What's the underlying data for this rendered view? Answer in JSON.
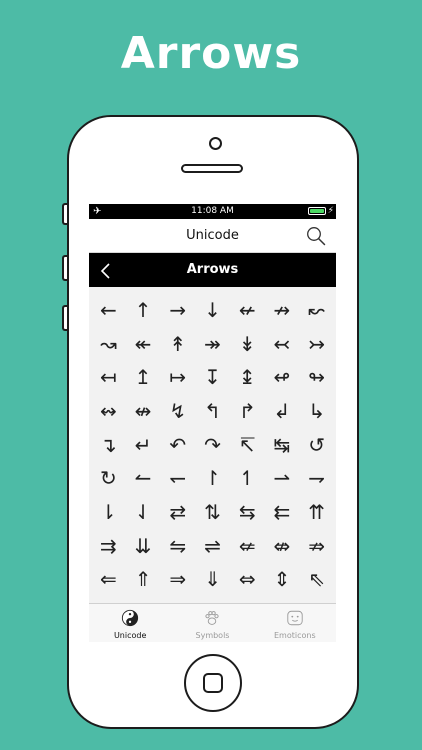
{
  "banner": {
    "title": "Arrows"
  },
  "status_bar": {
    "time": "11:08 AM",
    "airplane_glyph": "✈",
    "charging_glyph": "⚡"
  },
  "nav_bar": {
    "title": "Unicode",
    "search_icon": "search-icon"
  },
  "header": {
    "title": "Arrows",
    "back_glyph": "‹"
  },
  "arrows": [
    "←",
    "↑",
    "→",
    "↓",
    "↚",
    "↛",
    "↜",
    "↝",
    "↞",
    "↟",
    "↠",
    "↡",
    "↢",
    "↣",
    "↤",
    "↥",
    "↦",
    "↧",
    "↨",
    "↫",
    "↬",
    "↭",
    "↮",
    "↯",
    "↰",
    "↱",
    "↲",
    "↳",
    "↴",
    "↵",
    "↶",
    "↷",
    "↸",
    "↹",
    "↺",
    "↻",
    "↼",
    "↽",
    "↾",
    "↿",
    "⇀",
    "⇁",
    "⇂",
    "⇃",
    "⇄",
    "⇅",
    "⇆",
    "⇇",
    "⇈",
    "⇉",
    "⇊",
    "⇋",
    "⇌",
    "⇍",
    "⇎",
    "⇏",
    "⇐",
    "⇑",
    "⇒",
    "⇓",
    "⇔",
    "⇕",
    "⇖"
  ],
  "tabs": [
    {
      "label": "Unicode",
      "icon": "yin-yang-icon",
      "active": true
    },
    {
      "label": "Symbols",
      "icon": "paw-icon",
      "active": false
    },
    {
      "label": "Emoticons",
      "icon": "emoticon-face-icon",
      "active": false
    }
  ],
  "colors": {
    "background": "#4dbba6",
    "battery": "#4cd964",
    "header": "#000000",
    "inactive_tab": "#9a9a9a"
  }
}
